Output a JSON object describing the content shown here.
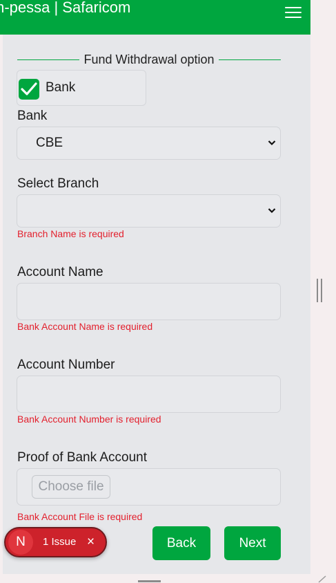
{
  "header": {
    "title": "m-pessa | Safaricom"
  },
  "form": {
    "legend": "Fund Withdrawal option",
    "checkbox_label": "Bank",
    "bank": {
      "label": "Bank",
      "selected": "CBE"
    },
    "branch": {
      "label": "Select Branch",
      "selected": "",
      "error": "Branch Name is required"
    },
    "account_name": {
      "label": "Account Name",
      "value": "",
      "error": "Bank Account Name is required"
    },
    "account_number": {
      "label": "Account Number",
      "value": "",
      "error": "Bank Account Number is required"
    },
    "proof": {
      "label": "Proof of Bank Account",
      "button": "Choose file",
      "error": "Bank Account File is required"
    }
  },
  "buttons": {
    "back": "Back",
    "next": "Next"
  },
  "issue_badge": {
    "avatar": "N",
    "text": "1 Issue",
    "close": "×"
  },
  "colors": {
    "brand": "#00a63f",
    "error": "#e3202d",
    "panel": "#e6e7ea",
    "badge": "#cd222b"
  }
}
